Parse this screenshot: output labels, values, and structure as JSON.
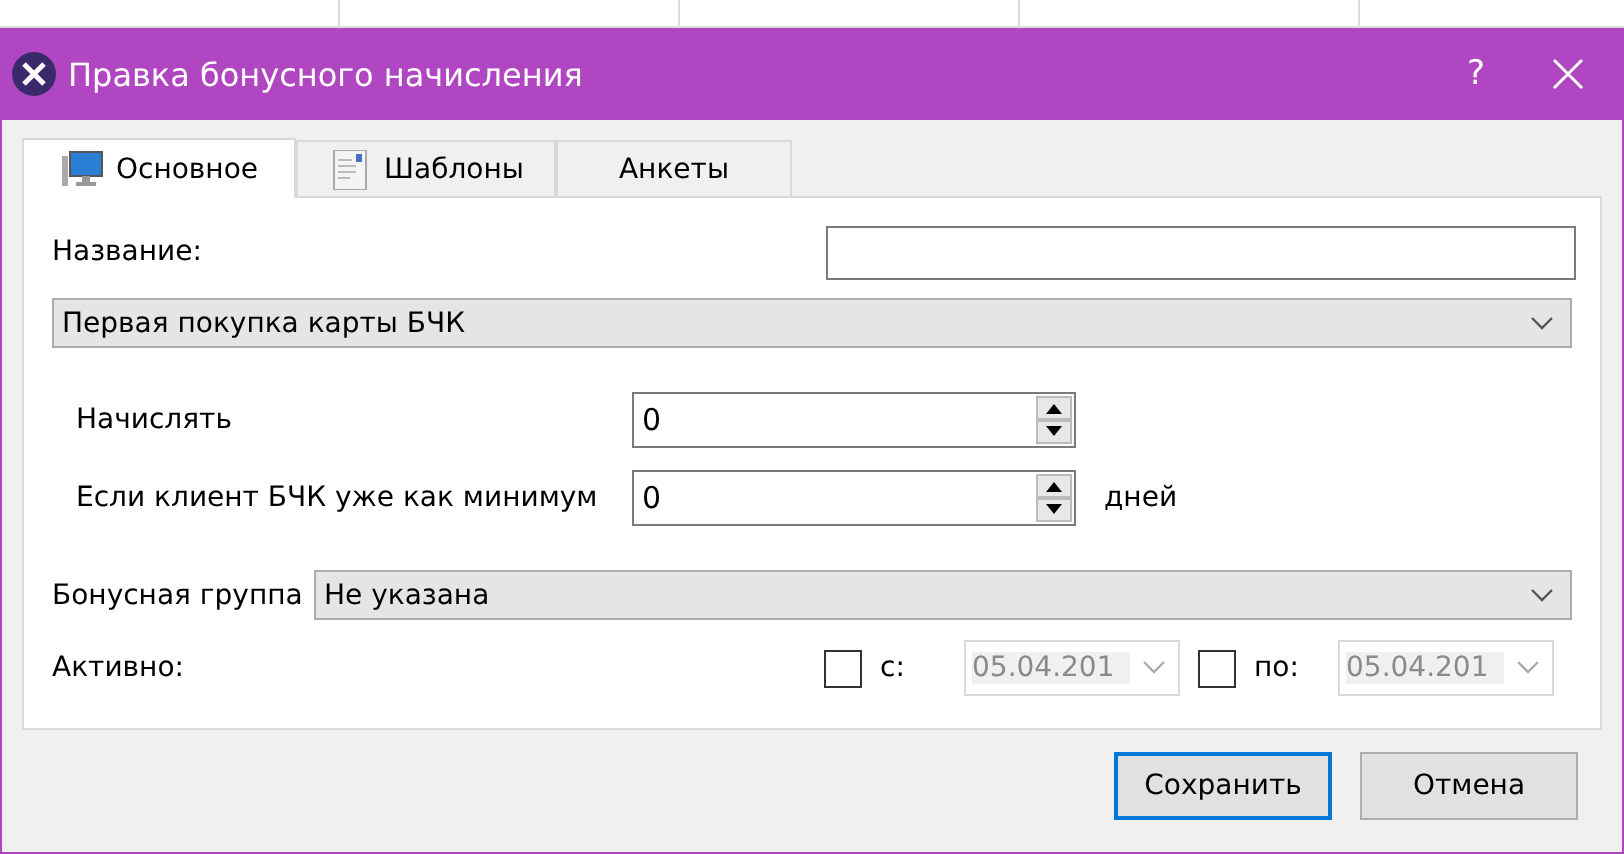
{
  "window": {
    "title": "Правка бонусного начисления",
    "help": "?"
  },
  "tabs": [
    {
      "label": "Основное",
      "selected": true,
      "kind": "monitor"
    },
    {
      "label": "Шаблоны",
      "selected": false,
      "kind": "document"
    },
    {
      "label": "Анкеты",
      "selected": false,
      "kind": "plain"
    }
  ],
  "name_field": {
    "label": "Название:"
  },
  "type_combo": {
    "value": "Первая покупка карты БЧК"
  },
  "accrue": {
    "label": "Начислять",
    "value": "0"
  },
  "min_days": {
    "label": "Если клиент БЧК уже как минимум",
    "value": "0",
    "unit": "дней"
  },
  "group": {
    "label": "Бонусная группа",
    "value": "Не указана"
  },
  "active": {
    "label": "Активно:",
    "from": {
      "label": "с:",
      "checked": false,
      "date": "05.04.201",
      "disabled": true
    },
    "to": {
      "label": "по:",
      "checked": false,
      "date": "05.04.201",
      "disabled": true
    }
  },
  "buttons": [
    {
      "label": "Сохранить",
      "default": true
    },
    {
      "label": "Отмена",
      "default": false
    }
  ]
}
